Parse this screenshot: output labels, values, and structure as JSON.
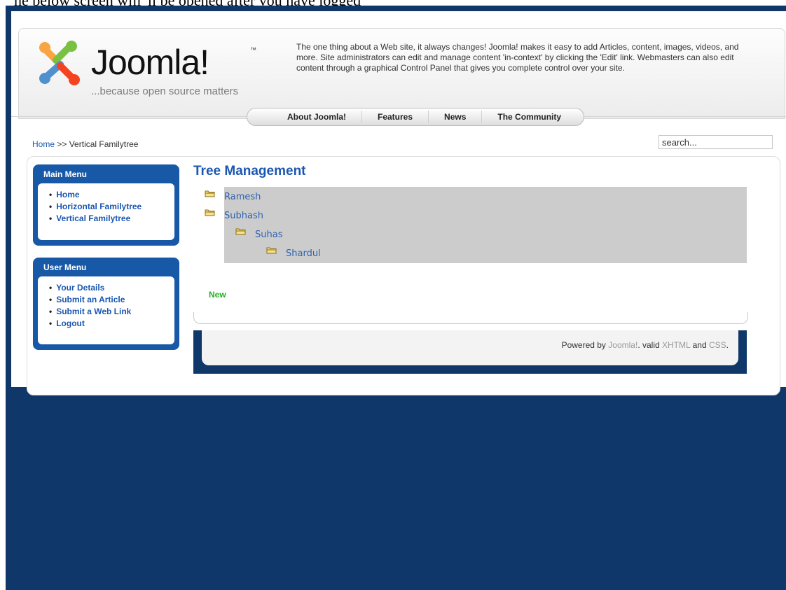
{
  "caption": "he below screen will 'll be opened after you have logged",
  "header": {
    "logo_word": "Joomla!",
    "logo_tm": "™",
    "logo_tagline": "...because open source matters",
    "intro_text": "The one thing about a Web site, it always changes! Joomla! makes it easy to add Articles, content, images, videos, and more. Site administrators can edit and manage content 'in-context' by clicking the 'Edit' link. Webmasters can also edit content through a graphical Control Panel that gives you complete control over your site."
  },
  "nav": {
    "items": [
      {
        "label": "About Joomla!"
      },
      {
        "label": "Features"
      },
      {
        "label": "News"
      },
      {
        "label": "The Community"
      }
    ]
  },
  "breadcrumb": {
    "home": "Home",
    "separator": ">>",
    "current": "Vertical Familytree"
  },
  "search": {
    "value": "search..."
  },
  "main_menu": {
    "title": "Main Menu",
    "items": [
      {
        "label": "Home"
      },
      {
        "label": "Horizontal Familytree"
      },
      {
        "label": "Vertical Familytree"
      }
    ]
  },
  "user_menu": {
    "title": "User Menu",
    "items": [
      {
        "label": "Your Details"
      },
      {
        "label": "Submit an Article"
      },
      {
        "label": "Submit a Web Link"
      },
      {
        "label": "Logout"
      }
    ]
  },
  "main": {
    "title": "Tree Management",
    "tree": [
      {
        "label": "Ramesh",
        "level": 0
      },
      {
        "label": "Subhash",
        "level": 0
      },
      {
        "label": "Suhas",
        "level": 1
      },
      {
        "label": "Shardul",
        "level": 2
      }
    ],
    "new_label": "New"
  },
  "footer": {
    "powered_by": "Powered by",
    "joomla_link": "Joomla!",
    "valid": ". valid",
    "xhtml": "XHTML",
    "and": "and",
    "css": "CSS",
    "end": "."
  },
  "colors": {
    "frame": "#0f3769",
    "module": "#1859a7",
    "link": "#1b57b1",
    "new": "#22b022",
    "tree_bg": "#cccccc"
  }
}
